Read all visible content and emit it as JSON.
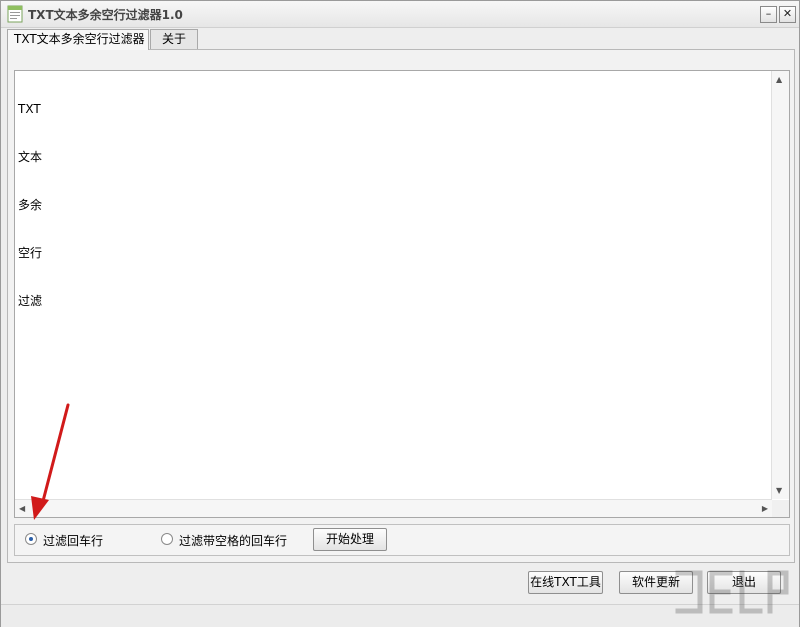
{
  "window": {
    "title": "TXT文本多余空行过滤器1.0",
    "minimize_symbol": "–",
    "close_symbol": "✕"
  },
  "tabs": [
    {
      "label": "TXT文本多余空行过滤器",
      "active": true
    },
    {
      "label": "关于",
      "active": false
    }
  ],
  "editor": {
    "lines": [
      "TXT",
      "文本",
      "多余",
      "空行",
      "过滤"
    ]
  },
  "options": {
    "radio1_label": "过滤回车行",
    "radio1_checked": true,
    "radio2_label": "过滤带空格的回车行",
    "radio2_checked": false,
    "start_button": "开始处理"
  },
  "footer": {
    "online_tools": "在线TXT工具",
    "update": "软件更新",
    "exit": "退出"
  },
  "colors": {
    "annotation_arrow": "#d11a1a",
    "radio_dot": "#2b5fa8"
  },
  "icons": [
    "app-icon",
    "scroll-up-icon",
    "scroll-down-icon",
    "scroll-left-icon",
    "scroll-right-icon",
    "annotation-arrow-icon",
    "watermark-logo"
  ]
}
